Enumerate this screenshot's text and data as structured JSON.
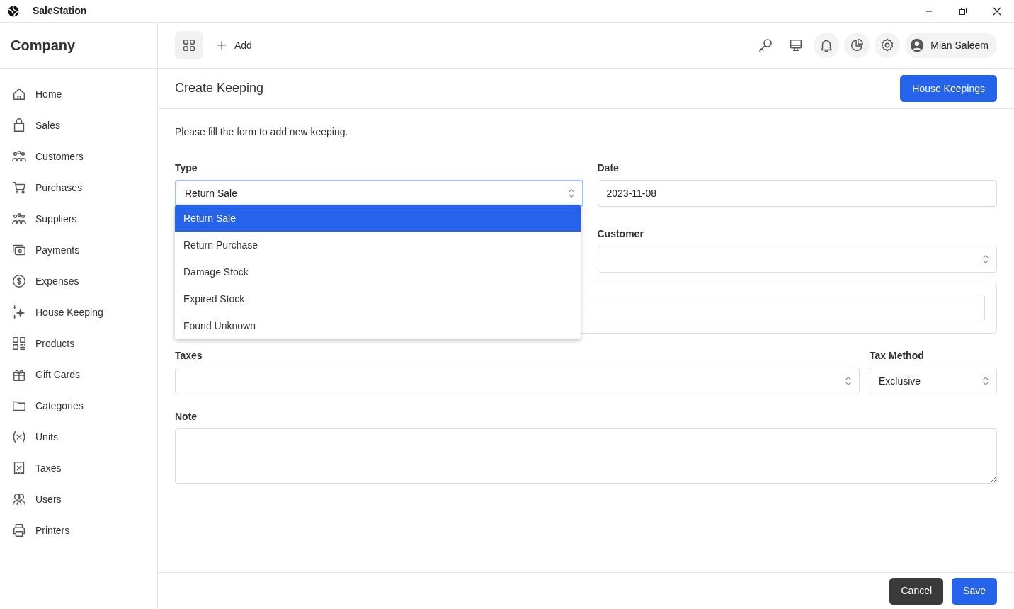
{
  "window": {
    "title": "SaleStation"
  },
  "sidebar": {
    "title": "Company",
    "items": [
      {
        "label": "Home"
      },
      {
        "label": "Sales"
      },
      {
        "label": "Customers"
      },
      {
        "label": "Purchases"
      },
      {
        "label": "Suppliers"
      },
      {
        "label": "Payments"
      },
      {
        "label": "Expenses"
      },
      {
        "label": "House Keeping"
      },
      {
        "label": "Products"
      },
      {
        "label": "Gift Cards"
      },
      {
        "label": "Categories"
      },
      {
        "label": "Units"
      },
      {
        "label": "Taxes"
      },
      {
        "label": "Users"
      },
      {
        "label": "Printers"
      }
    ]
  },
  "toolbar": {
    "add_label": "Add",
    "user": "Mian Saleem"
  },
  "page": {
    "title": "Create Keeping",
    "action": "House Keepings",
    "intro": "Please fill the form to add new keeping."
  },
  "form": {
    "type": {
      "label": "Type",
      "value": "Return Sale",
      "options": [
        {
          "label": "Return Sale",
          "selected": true
        },
        {
          "label": "Return Purchase",
          "selected": false
        },
        {
          "label": "Damage Stock",
          "selected": false
        },
        {
          "label": "Expired Stock",
          "selected": false
        },
        {
          "label": "Found Unknown",
          "selected": false
        }
      ]
    },
    "date": {
      "label": "Date",
      "value": "2023-11-08"
    },
    "customer": {
      "label": "Customer"
    },
    "taxes": {
      "label": "Taxes"
    },
    "tax_method": {
      "label": "Tax Method",
      "value": "Exclusive"
    },
    "note": {
      "label": "Note"
    }
  },
  "footer": {
    "cancel": "Cancel",
    "save": "Save"
  }
}
